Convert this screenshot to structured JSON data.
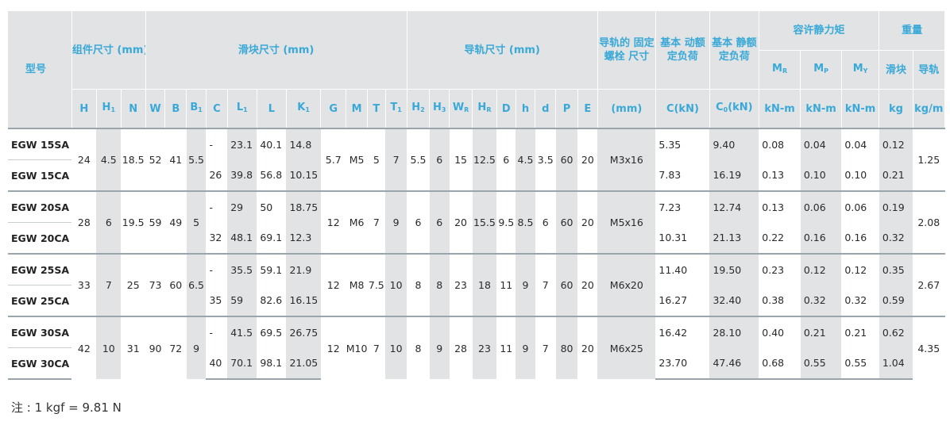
{
  "header": {
    "model": "型号",
    "assembly": "组件尺寸 (mm)",
    "block": "滑块尺寸 (mm)",
    "rail": "导轨尺寸 (mm)",
    "rail_bolt": "导轨的 固定螺栓 尺寸",
    "dyn_load": "基本 动额 定负荷",
    "static_load": "基本 静额 定负荷",
    "static_moment": "容许静力矩",
    "weight": "重量",
    "block_weight": "滑块",
    "rail_weight": "导轨",
    "col_H": "H",
    "col_H1": "H",
    "col_N": "N",
    "col_W": "W",
    "col_B": "B",
    "col_B1": "B",
    "col_C": "C",
    "col_L1": "L",
    "col_L": "L",
    "col_K1": "K",
    "col_G": "G",
    "col_M": "M",
    "col_T": "T",
    "col_T1": "T",
    "col_H2": "H",
    "col_H3": "H",
    "col_WR": "W",
    "col_HR": "H",
    "col_D": "D",
    "col_h": "h",
    "col_d": "d",
    "col_P": "P",
    "col_E": "E",
    "sub_1": "1",
    "sub_2": "2",
    "sub_3": "3",
    "sub_R": "R",
    "sub_0": "0",
    "sub_Pm": "P",
    "sub_Y": "Y",
    "col_MR": "M",
    "col_MP": "M",
    "col_MY": "M",
    "unit_mm": "(mm)",
    "unit_C": "C(kN)",
    "unit_C0_pre": "C",
    "unit_C0_post": "(kN)",
    "unit_knm": "kN-m",
    "unit_kg": "kg",
    "unit_kgm": "kg/m"
  },
  "groups": [
    {
      "H": "24",
      "H1": "4.5",
      "N": "18.5",
      "W": "52",
      "B": "41",
      "B1": "5.5",
      "G": "5.7",
      "M": "M5",
      "T": "5",
      "T1": "7",
      "H2": "5.5",
      "H3": "6",
      "WR": "15",
      "HR": "12.5",
      "D": "6",
      "h": "4.5",
      "d": "3.5",
      "P": "60",
      "E": "20",
      "bolt": "M3x16",
      "rail_w": "1.25",
      "rows": [
        {
          "model": "EGW 15SA",
          "C": "-",
          "L1": "23.1",
          "L": "40.1",
          "K1": "14.8",
          "Cdyn": "5.35",
          "C0": "9.40",
          "MR": "0.08",
          "MP": "0.04",
          "MY": "0.04",
          "kg": "0.12"
        },
        {
          "model": "EGW 15CA",
          "C": "26",
          "L1": "39.8",
          "L": "56.8",
          "K1": "10.15",
          "Cdyn": "7.83",
          "C0": "16.19",
          "MR": "0.13",
          "MP": "0.10",
          "MY": "0.10",
          "kg": "0.21"
        }
      ]
    },
    {
      "H": "28",
      "H1": "6",
      "N": "19.5",
      "W": "59",
      "B": "49",
      "B1": "5",
      "G": "12",
      "M": "M6",
      "T": "7",
      "T1": "9",
      "H2": "6",
      "H3": "6",
      "WR": "20",
      "HR": "15.5",
      "D": "9.5",
      "h": "8.5",
      "d": "6",
      "P": "60",
      "E": "20",
      "bolt": "M5x16",
      "rail_w": "2.08",
      "rows": [
        {
          "model": "EGW 20SA",
          "C": "-",
          "L1": "29",
          "L": "50",
          "K1": "18.75",
          "Cdyn": "7.23",
          "C0": "12.74",
          "MR": "0.13",
          "MP": "0.06",
          "MY": "0.06",
          "kg": "0.19"
        },
        {
          "model": "EGW 20CA",
          "C": "32",
          "L1": "48.1",
          "L": "69.1",
          "K1": "12.3",
          "Cdyn": "10.31",
          "C0": "21.13",
          "MR": "0.22",
          "MP": "0.16",
          "MY": "0.16",
          "kg": "0.32"
        }
      ]
    },
    {
      "H": "33",
      "H1": "7",
      "N": "25",
      "W": "73",
      "B": "60",
      "B1": "6.5",
      "G": "12",
      "M": "M8",
      "T": "7.5",
      "T1": "10",
      "H2": "8",
      "H3": "8",
      "WR": "23",
      "HR": "18",
      "D": "11",
      "h": "9",
      "d": "7",
      "P": "60",
      "E": "20",
      "bolt": "M6x20",
      "rail_w": "2.67",
      "rows": [
        {
          "model": "EGW 25SA",
          "C": "-",
          "L1": "35.5",
          "L": "59.1",
          "K1": "21.9",
          "Cdyn": "11.40",
          "C0": "19.50",
          "MR": "0.23",
          "MP": "0.12",
          "MY": "0.12",
          "kg": "0.35"
        },
        {
          "model": "EGW 25CA",
          "C": "35",
          "L1": "59",
          "L": "82.6",
          "K1": "16.15",
          "Cdyn": "16.27",
          "C0": "32.40",
          "MR": "0.38",
          "MP": "0.32",
          "MY": "0.32",
          "kg": "0.59"
        }
      ]
    },
    {
      "H": "42",
      "H1": "10",
      "N": "31",
      "W": "90",
      "B": "72",
      "B1": "9",
      "G": "12",
      "M": "M10",
      "T": "7",
      "T1": "10",
      "H2": "8",
      "H3": "9",
      "WR": "28",
      "HR": "23",
      "D": "11",
      "h": "9",
      "d": "7",
      "P": "80",
      "E": "20",
      "bolt": "M6x25",
      "rail_w": "4.35",
      "rows": [
        {
          "model": "EGW 30SA",
          "C": "-",
          "L1": "41.5",
          "L": "69.5",
          "K1": "26.75",
          "Cdyn": "16.42",
          "C0": "28.10",
          "MR": "0.40",
          "MP": "0.21",
          "MY": "0.21",
          "kg": "0.62"
        },
        {
          "model": "EGW 30CA",
          "C": "40",
          "L1": "70.1",
          "L": "98.1",
          "K1": "21.05",
          "Cdyn": "23.70",
          "C0": "47.46",
          "MR": "0.68",
          "MP": "0.55",
          "MY": "0.55",
          "kg": "1.04"
        }
      ]
    }
  ],
  "footnote": "注 : 1 kgf = 9.81 N"
}
